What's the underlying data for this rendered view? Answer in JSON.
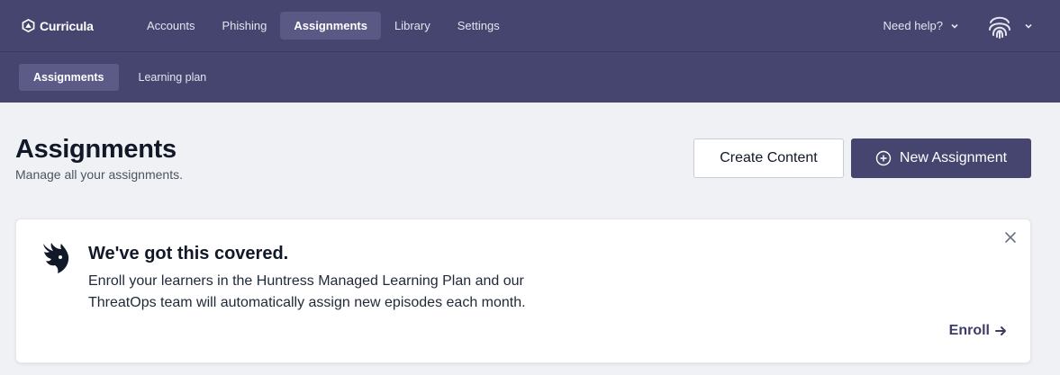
{
  "app": {
    "logo_text": "Curricula"
  },
  "nav": {
    "items": [
      {
        "label": "Accounts",
        "active": false
      },
      {
        "label": "Phishing",
        "active": false
      },
      {
        "label": "Assignments",
        "active": true
      },
      {
        "label": "Library",
        "active": false
      },
      {
        "label": "Settings",
        "active": false
      }
    ],
    "help_label": "Need help?",
    "profile_icon": "fingerprint-icon"
  },
  "subnav": {
    "items": [
      {
        "label": "Assignments",
        "active": true
      },
      {
        "label": "Learning plan",
        "active": false
      }
    ]
  },
  "page": {
    "title": "Assignments",
    "subtitle": "Manage all your assignments.",
    "create_label": "Create Content",
    "new_label": "New Assignment"
  },
  "banner": {
    "title": "We've got this covered.",
    "text": "Enroll your learners in the Huntress Managed Learning Plan and our ThreatOps team will automatically assign new episodes each month.",
    "cta": "Enroll"
  },
  "colors": {
    "brand": "#46456f",
    "background": "#f0f1f5"
  }
}
